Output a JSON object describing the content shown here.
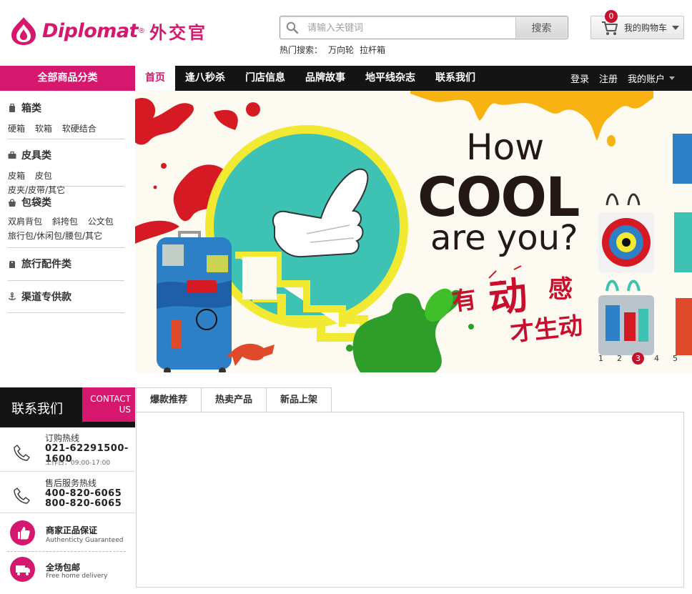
{
  "header": {
    "logo_text": "Diplomat",
    "logo_reg": "®",
    "logo_cn": "外交官",
    "search": {
      "placeholder": "请输入关键词",
      "button": "搜索"
    },
    "hot_search": {
      "label": "热门搜索：",
      "links": [
        "万向轮",
        "拉杆箱"
      ]
    },
    "cart": {
      "count": "0",
      "label": "我的购物车"
    }
  },
  "nav": {
    "category_label": "全部商品分类",
    "items": [
      "首页",
      "逢八秒杀",
      "门店信息",
      "品牌故事",
      "地平线杂志",
      "联系我们"
    ],
    "active_index": 0,
    "right": {
      "login": "登录",
      "register": "注册",
      "account": "我的账户"
    }
  },
  "sidebar": {
    "categories": [
      {
        "title": "箱类",
        "icon": "suitcase-icon",
        "links": [
          "硬箱",
          "软箱",
          "软硬结合"
        ]
      },
      {
        "title": "皮具类",
        "icon": "briefcase-icon",
        "links": [
          "皮箱",
          "皮包",
          "皮夹/皮带/其它"
        ]
      },
      {
        "title": "包袋类",
        "icon": "bag-icon",
        "links": [
          "双肩背包",
          "斜挎包",
          "公文包",
          "旅行包/休闲包/腰包/其它"
        ]
      },
      {
        "title": "旅行配件类",
        "icon": "luggage-tag-icon",
        "links": []
      },
      {
        "title": "渠道专供款",
        "icon": "anchor-icon",
        "links": []
      }
    ]
  },
  "banner": {
    "headline_1": "How",
    "headline_2": "COOL",
    "headline_3": "are you?",
    "cn_1a": "有",
    "cn_1b": "动",
    "cn_1c": "感",
    "cn_2": "才生动",
    "pager": [
      "1",
      "2",
      "3",
      "4",
      "5"
    ],
    "active_page": 3
  },
  "contact": {
    "title": "联系我们",
    "en_line1": "CONTACT",
    "en_line2": "US",
    "order_hotline": {
      "label": "订购热线",
      "number": "021-62291500-1600",
      "hours": "工作日：09:00-17:00"
    },
    "service_hotline": {
      "label": "售后服务热线",
      "number1": "400-820-6065",
      "number2": "800-820-6065"
    },
    "guarantee": {
      "title": "商家正品保证",
      "subtitle": "Authenticty Guaranteed"
    },
    "shipping": {
      "title": "全场包邮",
      "subtitle": "Free home delivery"
    }
  },
  "tabs": [
    "爆款推荐",
    "热卖产品",
    "新品上架"
  ],
  "colors": {
    "brand": "#d6176e",
    "navbar": "#141414",
    "pager_active": "#c8102e"
  }
}
